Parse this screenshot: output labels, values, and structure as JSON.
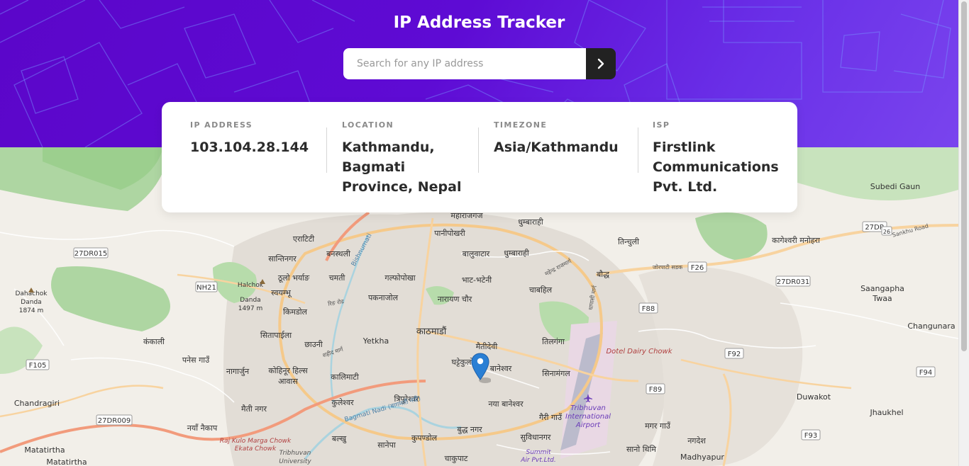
{
  "header": {
    "title": "IP Address Tracker",
    "search_placeholder": "Search for any IP address",
    "submit_icon": "chevron-right-icon"
  },
  "info": {
    "ip_label": "IP ADDRESS",
    "ip_value": "103.104.28.144",
    "location_label": "LOCATION",
    "location_value": "Kathmandu, Bagmati Province, Nepal",
    "timezone_label": "TIMEZONE",
    "timezone_value": "Asia/Kathmandu",
    "isp_label": "ISP",
    "isp_value": "Firstlink Communications Pvt. Ltd."
  },
  "map": {
    "marker_icon": "map-pin-icon",
    "places": {
      "maharajganj": "महाराजगंज",
      "dhumbarahi": "धुम्बाराही",
      "panipokhari": "पानीपोखरी",
      "eratiti": "एराटिटी",
      "banasthali": "बनस्थली",
      "santinagar": "सान्तिनगर",
      "baluwatar": "बालुवाटार",
      "dhumbarahi2": "धुम्बाराही",
      "tinchuli": "तिन्चुली",
      "kageshwori": "कागेश्वरी मनोहरा",
      "subedi": "Subedi Gaun",
      "r27dr": "27DR",
      "r27dr015": "27DR015",
      "thulo_bharyang": "ठूलो भर्याङ",
      "chamati": "चमती",
      "galphopokha": "गल्फोपोखा",
      "bhatbhateni": "भाट-भटेनी",
      "baudha": "बौद्ध",
      "f26": "F26",
      "r27dr031": "27DR031",
      "nh21": "NH21",
      "halchok": "Halchok",
      "halchok_danda": "Danda",
      "halchok_elev": "1497 m",
      "swayambhu": "स्वयम्भू",
      "dahachok": "Dahachok",
      "dahachok_danda": "Danda",
      "dahachok_elev": "1874 m",
      "pakanajol": "पकनाजोल",
      "narayanchaur": "नारायण चौर",
      "chabahil": "चाबहिल",
      "saangapha": "Saangapha",
      "twaa": "Twaa",
      "kimdol": "किमडोल",
      "f88": "F88",
      "kathmandu": "काठमाडौं",
      "sitapaila": "सितापाईला",
      "yetkha": "Yetkha",
      "maitidevi": "मैतीदेवी",
      "tilganga": "तिलगंगा",
      "changunara": "Changunara",
      "kankali": "कंकाली",
      "chauni": "छाउनी",
      "dotel": "Dotel Dairy Chowk",
      "f92": "F92",
      "f105": "F105",
      "panesgaun": "पनेस गाउँ",
      "nagarjun": "नागार्जुन",
      "kohinoor": "कोहिनूर हिल्स",
      "awas": "आवास",
      "kalimati": "कालिमाटी",
      "ghattekulo": "घट्टेकुलो",
      "baneshwor": "बानेश्वर",
      "sinamangal": "सिनामंगल",
      "f94": "F94",
      "chandragiri": "Chandragiri",
      "maitinagar": "मैती नगर",
      "kuleshwor": "कुलेश्वर",
      "tripureshwor": "त्रिपुरेश्वर",
      "naya_baneshwor": "नया बानेश्वर",
      "f89": "F89",
      "duwakot": "Duwakot",
      "r27dr009": "27DR009",
      "tribhuvan_airport_1": "Tribhuvan",
      "tribhuvan_airport_2": "International",
      "tribhuvan_airport_3": "Airport",
      "gairigaun": "गैरी गाउँ",
      "jhaukhel": "Jhaukhel",
      "naya_naikap": "नयाँ नैकाप",
      "buddhanagar": "बुद्ध नगर",
      "subidhanagar": "सुविधानगर",
      "magargaun": "मगर गाउँ",
      "nagadesh": "नगदेश",
      "kulo_marga": "Raj Kulo Marga Chowk",
      "ekata": "Ekata Chowk",
      "tribhuvan_univ_1": "Tribhuvan",
      "tribhuvan_univ_2": "University",
      "balkhu": "बल्खु",
      "sanepa": "सानेपा",
      "kupondol": "कुपण्डोल",
      "summit_1": "Summit",
      "summit_2": "Air Pvt.Ltd.",
      "sanothimi": "सानो थिमि",
      "madhyapur": "Madhyapur",
      "f93": "F93",
      "matatirtha": "Matatirtha",
      "matatirtha2": "Matatirtha",
      "chakupat": "चाकुपाट",
      "bagmati_river": "Bagmati Nadi (बागमती नदी)",
      "bishnumati": "Bishnumati",
      "ring_road": "रिङ रोड",
      "sankhu_road": "Sankhu Road",
      "jorpati": "जोरपाटी सडक",
      "mahendra": "महेन्द्र राजमार्ग",
      "dhapasi": "धापासी मार्ग",
      "sahid": "शहीद मार्ग",
      "r26": "26"
    }
  }
}
